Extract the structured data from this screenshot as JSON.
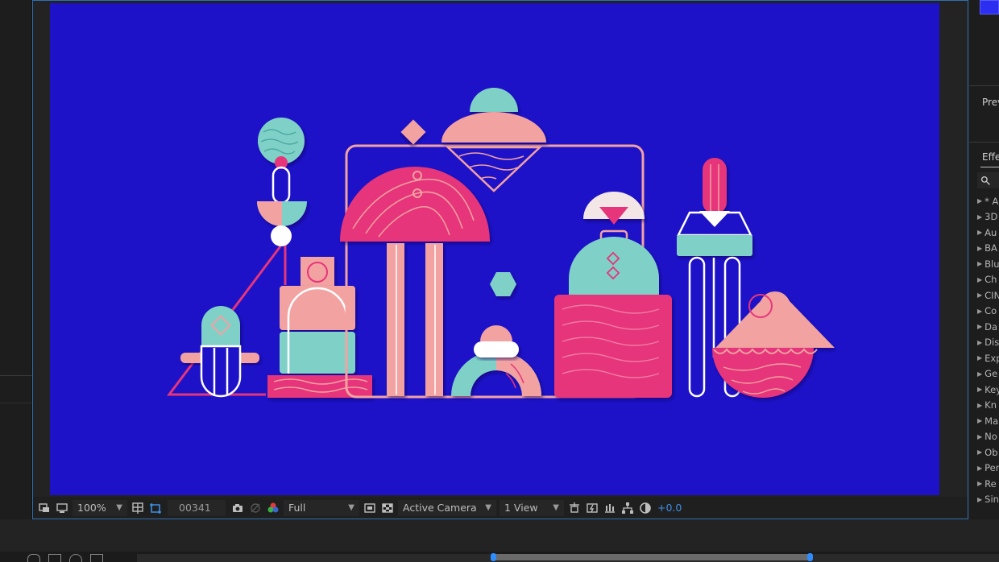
{
  "toolbar": {
    "zoom": "100%",
    "timecode": "00341",
    "resolution": "Full",
    "camera": "Active Camera",
    "views": "1 View",
    "exposure": "+0.0"
  },
  "right_panel": {
    "preview_label": "Prev",
    "effects_label": "Effe",
    "effects_items": [
      "* A",
      "3D",
      "Au",
      "BA",
      "Blu",
      "Ch",
      "CIN",
      "Co",
      "Da",
      "Dis",
      "Exp",
      "Ge",
      "Key",
      "Kn",
      "Ma",
      "No",
      "Ob",
      "Per",
      "Re",
      "Sin"
    ]
  },
  "colors": {
    "canvas_bg": "#1d12c8",
    "pink": "#e6357a",
    "peach": "#f3a2a2",
    "teal": "#7fd1c8",
    "accent_blue": "#3d8ee6"
  },
  "icons": [
    "region-of-interest-icon",
    "display-icon",
    "grid-guides-icon",
    "mask-toggle-icon",
    "camera-snapshot-icon",
    "show-snapshot-icon",
    "channels-icon",
    "fast-previews-icon",
    "transparency-grid-icon",
    "3d-view-icon",
    "timeline-icon",
    "flowchart-icon",
    "exposure-reset-icon",
    "search-icon"
  ]
}
